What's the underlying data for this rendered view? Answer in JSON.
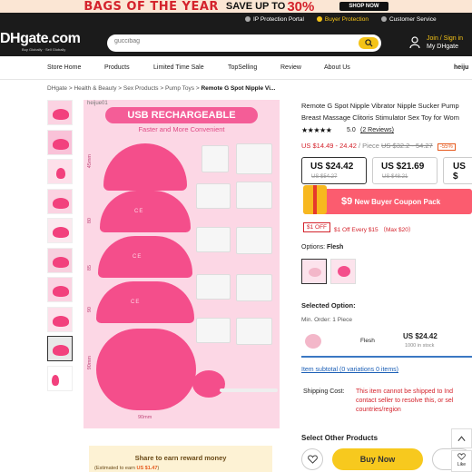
{
  "banner": {
    "headline": "BAGS OF THE YEAR",
    "sale_prefix": "SAVE UP TO",
    "percent": "30%",
    "cta": "SHOP NOW"
  },
  "header": {
    "top_links": [
      "IP Protection Portal",
      "Buyer Protection",
      "Customer Service"
    ],
    "logo": "DHgate.com",
    "logo_tagline": "Buy Globally · Sell Globally",
    "search_placeholder": "guccibag",
    "signin": "Join / Sign in",
    "account": "My DHgate"
  },
  "nav": [
    "Store Home",
    "Products",
    "Limited Time Sale",
    "TopSelling",
    "Review",
    "About Us",
    "heiju"
  ],
  "breadcrumb": {
    "items": [
      "DHgate",
      "Health & Beauty",
      "Sex Products",
      "Pump Toys"
    ],
    "current": "Remote G Spot Nipple Vi..."
  },
  "gallery": {
    "shop_tag": "heijue01",
    "title": "USB RECHARGEABLE",
    "subtitle": "Faster and More Convenient",
    "dims": [
      "45mm",
      "80",
      "85",
      "90",
      "90mm"
    ],
    "bottom_dim": "90mm",
    "product_label": "CE"
  },
  "share": {
    "title": "Share to earn reward money",
    "line_prefix": "(Estimated to earn",
    "amount": "US $1.47",
    "line_suffix": ")"
  },
  "product": {
    "title": "Remote G Spot Nipple Vibrator Nipple Sucker Pump Breast Massage Clitoris Stimulator Sex Toy for Wom",
    "stars": "★★★★★",
    "rating": "5.0",
    "reviews": "(2 Reviews)",
    "price_range": "US $14.49 - 24.42",
    "per": "/ Piece",
    "old_range": "US $32.2 - 54.27",
    "discount": "-55%",
    "tiers": [
      {
        "price": "US $24.42",
        "old": "US $54.27"
      },
      {
        "price": "US $21.69",
        "old": "US $48.21"
      },
      {
        "price": "US $",
        "old": ""
      }
    ],
    "coupon_amount": "$9",
    "coupon_text": "New Buyer Coupon Pack",
    "off_badge": "$1 OFF",
    "off_text": "$1 Off Every $15 （Max $20）",
    "options_label": "Options:",
    "option_value": "Flesh",
    "selected_option_label": "Selected Option:",
    "min_order": "Min. Order: 1 Piece",
    "selected_name": "Flesh",
    "selected_price": "US $24.42",
    "stock": "1000 in stock",
    "subtotal": "Item subtotal (0 variations 0 items)",
    "shipping_label": "Shipping Cost:",
    "shipping_text": "This item cannot be shipped to Ind contact seller to resolve this, or sel countries/region",
    "other_products": "Select Other Products",
    "buy_now": "Buy Now"
  },
  "side": {
    "like": "Like"
  },
  "colors": {
    "accent_yellow": "#f4c317",
    "price_red": "#d4232c",
    "coupon_pink": "#fb5c6f",
    "product_pink": "#f44e8b"
  }
}
